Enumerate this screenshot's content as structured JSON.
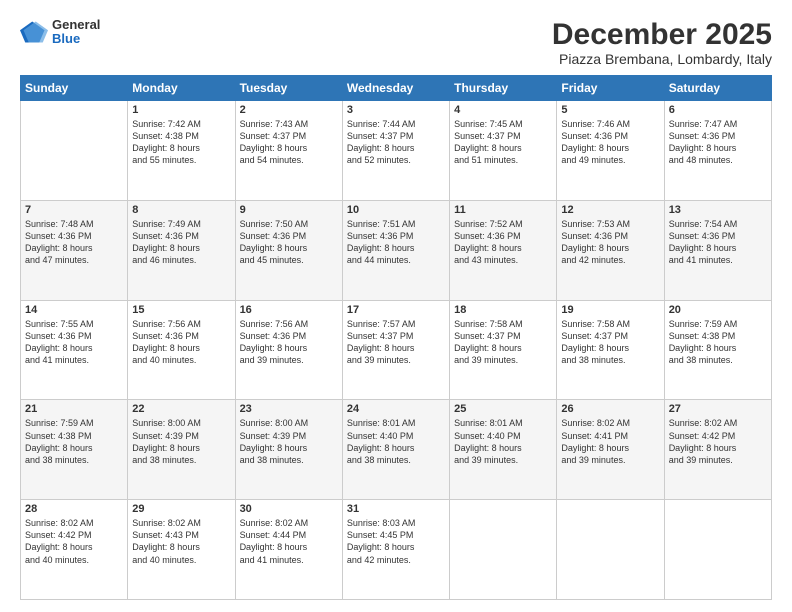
{
  "header": {
    "logo": {
      "general": "General",
      "blue": "Blue"
    },
    "title": "December 2025",
    "location": "Piazza Brembana, Lombardy, Italy"
  },
  "days_of_week": [
    "Sunday",
    "Monday",
    "Tuesday",
    "Wednesday",
    "Thursday",
    "Friday",
    "Saturday"
  ],
  "weeks": [
    [
      {
        "day": "",
        "info": ""
      },
      {
        "day": "1",
        "info": "Sunrise: 7:42 AM\nSunset: 4:38 PM\nDaylight: 8 hours\nand 55 minutes."
      },
      {
        "day": "2",
        "info": "Sunrise: 7:43 AM\nSunset: 4:37 PM\nDaylight: 8 hours\nand 54 minutes."
      },
      {
        "day": "3",
        "info": "Sunrise: 7:44 AM\nSunset: 4:37 PM\nDaylight: 8 hours\nand 52 minutes."
      },
      {
        "day": "4",
        "info": "Sunrise: 7:45 AM\nSunset: 4:37 PM\nDaylight: 8 hours\nand 51 minutes."
      },
      {
        "day": "5",
        "info": "Sunrise: 7:46 AM\nSunset: 4:36 PM\nDaylight: 8 hours\nand 49 minutes."
      },
      {
        "day": "6",
        "info": "Sunrise: 7:47 AM\nSunset: 4:36 PM\nDaylight: 8 hours\nand 48 minutes."
      }
    ],
    [
      {
        "day": "7",
        "info": "Sunrise: 7:48 AM\nSunset: 4:36 PM\nDaylight: 8 hours\nand 47 minutes."
      },
      {
        "day": "8",
        "info": "Sunrise: 7:49 AM\nSunset: 4:36 PM\nDaylight: 8 hours\nand 46 minutes."
      },
      {
        "day": "9",
        "info": "Sunrise: 7:50 AM\nSunset: 4:36 PM\nDaylight: 8 hours\nand 45 minutes."
      },
      {
        "day": "10",
        "info": "Sunrise: 7:51 AM\nSunset: 4:36 PM\nDaylight: 8 hours\nand 44 minutes."
      },
      {
        "day": "11",
        "info": "Sunrise: 7:52 AM\nSunset: 4:36 PM\nDaylight: 8 hours\nand 43 minutes."
      },
      {
        "day": "12",
        "info": "Sunrise: 7:53 AM\nSunset: 4:36 PM\nDaylight: 8 hours\nand 42 minutes."
      },
      {
        "day": "13",
        "info": "Sunrise: 7:54 AM\nSunset: 4:36 PM\nDaylight: 8 hours\nand 41 minutes."
      }
    ],
    [
      {
        "day": "14",
        "info": "Sunrise: 7:55 AM\nSunset: 4:36 PM\nDaylight: 8 hours\nand 41 minutes."
      },
      {
        "day": "15",
        "info": "Sunrise: 7:56 AM\nSunset: 4:36 PM\nDaylight: 8 hours\nand 40 minutes."
      },
      {
        "day": "16",
        "info": "Sunrise: 7:56 AM\nSunset: 4:36 PM\nDaylight: 8 hours\nand 39 minutes."
      },
      {
        "day": "17",
        "info": "Sunrise: 7:57 AM\nSunset: 4:37 PM\nDaylight: 8 hours\nand 39 minutes."
      },
      {
        "day": "18",
        "info": "Sunrise: 7:58 AM\nSunset: 4:37 PM\nDaylight: 8 hours\nand 39 minutes."
      },
      {
        "day": "19",
        "info": "Sunrise: 7:58 AM\nSunset: 4:37 PM\nDaylight: 8 hours\nand 38 minutes."
      },
      {
        "day": "20",
        "info": "Sunrise: 7:59 AM\nSunset: 4:38 PM\nDaylight: 8 hours\nand 38 minutes."
      }
    ],
    [
      {
        "day": "21",
        "info": "Sunrise: 7:59 AM\nSunset: 4:38 PM\nDaylight: 8 hours\nand 38 minutes."
      },
      {
        "day": "22",
        "info": "Sunrise: 8:00 AM\nSunset: 4:39 PM\nDaylight: 8 hours\nand 38 minutes."
      },
      {
        "day": "23",
        "info": "Sunrise: 8:00 AM\nSunset: 4:39 PM\nDaylight: 8 hours\nand 38 minutes."
      },
      {
        "day": "24",
        "info": "Sunrise: 8:01 AM\nSunset: 4:40 PM\nDaylight: 8 hours\nand 38 minutes."
      },
      {
        "day": "25",
        "info": "Sunrise: 8:01 AM\nSunset: 4:40 PM\nDaylight: 8 hours\nand 39 minutes."
      },
      {
        "day": "26",
        "info": "Sunrise: 8:02 AM\nSunset: 4:41 PM\nDaylight: 8 hours\nand 39 minutes."
      },
      {
        "day": "27",
        "info": "Sunrise: 8:02 AM\nSunset: 4:42 PM\nDaylight: 8 hours\nand 39 minutes."
      }
    ],
    [
      {
        "day": "28",
        "info": "Sunrise: 8:02 AM\nSunset: 4:42 PM\nDaylight: 8 hours\nand 40 minutes."
      },
      {
        "day": "29",
        "info": "Sunrise: 8:02 AM\nSunset: 4:43 PM\nDaylight: 8 hours\nand 40 minutes."
      },
      {
        "day": "30",
        "info": "Sunrise: 8:02 AM\nSunset: 4:44 PM\nDaylight: 8 hours\nand 41 minutes."
      },
      {
        "day": "31",
        "info": "Sunrise: 8:03 AM\nSunset: 4:45 PM\nDaylight: 8 hours\nand 42 minutes."
      },
      {
        "day": "",
        "info": ""
      },
      {
        "day": "",
        "info": ""
      },
      {
        "day": "",
        "info": ""
      }
    ]
  ]
}
